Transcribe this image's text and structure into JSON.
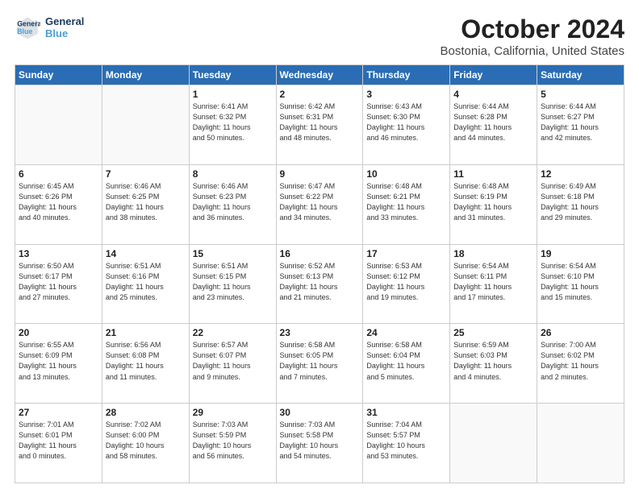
{
  "header": {
    "logo_line1": "General",
    "logo_line2": "Blue",
    "title": "October 2024",
    "subtitle": "Bostonia, California, United States"
  },
  "days_of_week": [
    "Sunday",
    "Monday",
    "Tuesday",
    "Wednesday",
    "Thursday",
    "Friday",
    "Saturday"
  ],
  "weeks": [
    [
      {
        "day": "",
        "detail": ""
      },
      {
        "day": "",
        "detail": ""
      },
      {
        "day": "1",
        "detail": "Sunrise: 6:41 AM\nSunset: 6:32 PM\nDaylight: 11 hours\nand 50 minutes."
      },
      {
        "day": "2",
        "detail": "Sunrise: 6:42 AM\nSunset: 6:31 PM\nDaylight: 11 hours\nand 48 minutes."
      },
      {
        "day": "3",
        "detail": "Sunrise: 6:43 AM\nSunset: 6:30 PM\nDaylight: 11 hours\nand 46 minutes."
      },
      {
        "day": "4",
        "detail": "Sunrise: 6:44 AM\nSunset: 6:28 PM\nDaylight: 11 hours\nand 44 minutes."
      },
      {
        "day": "5",
        "detail": "Sunrise: 6:44 AM\nSunset: 6:27 PM\nDaylight: 11 hours\nand 42 minutes."
      }
    ],
    [
      {
        "day": "6",
        "detail": "Sunrise: 6:45 AM\nSunset: 6:26 PM\nDaylight: 11 hours\nand 40 minutes."
      },
      {
        "day": "7",
        "detail": "Sunrise: 6:46 AM\nSunset: 6:25 PM\nDaylight: 11 hours\nand 38 minutes."
      },
      {
        "day": "8",
        "detail": "Sunrise: 6:46 AM\nSunset: 6:23 PM\nDaylight: 11 hours\nand 36 minutes."
      },
      {
        "day": "9",
        "detail": "Sunrise: 6:47 AM\nSunset: 6:22 PM\nDaylight: 11 hours\nand 34 minutes."
      },
      {
        "day": "10",
        "detail": "Sunrise: 6:48 AM\nSunset: 6:21 PM\nDaylight: 11 hours\nand 33 minutes."
      },
      {
        "day": "11",
        "detail": "Sunrise: 6:48 AM\nSunset: 6:19 PM\nDaylight: 11 hours\nand 31 minutes."
      },
      {
        "day": "12",
        "detail": "Sunrise: 6:49 AM\nSunset: 6:18 PM\nDaylight: 11 hours\nand 29 minutes."
      }
    ],
    [
      {
        "day": "13",
        "detail": "Sunrise: 6:50 AM\nSunset: 6:17 PM\nDaylight: 11 hours\nand 27 minutes."
      },
      {
        "day": "14",
        "detail": "Sunrise: 6:51 AM\nSunset: 6:16 PM\nDaylight: 11 hours\nand 25 minutes."
      },
      {
        "day": "15",
        "detail": "Sunrise: 6:51 AM\nSunset: 6:15 PM\nDaylight: 11 hours\nand 23 minutes."
      },
      {
        "day": "16",
        "detail": "Sunrise: 6:52 AM\nSunset: 6:13 PM\nDaylight: 11 hours\nand 21 minutes."
      },
      {
        "day": "17",
        "detail": "Sunrise: 6:53 AM\nSunset: 6:12 PM\nDaylight: 11 hours\nand 19 minutes."
      },
      {
        "day": "18",
        "detail": "Sunrise: 6:54 AM\nSunset: 6:11 PM\nDaylight: 11 hours\nand 17 minutes."
      },
      {
        "day": "19",
        "detail": "Sunrise: 6:54 AM\nSunset: 6:10 PM\nDaylight: 11 hours\nand 15 minutes."
      }
    ],
    [
      {
        "day": "20",
        "detail": "Sunrise: 6:55 AM\nSunset: 6:09 PM\nDaylight: 11 hours\nand 13 minutes."
      },
      {
        "day": "21",
        "detail": "Sunrise: 6:56 AM\nSunset: 6:08 PM\nDaylight: 11 hours\nand 11 minutes."
      },
      {
        "day": "22",
        "detail": "Sunrise: 6:57 AM\nSunset: 6:07 PM\nDaylight: 11 hours\nand 9 minutes."
      },
      {
        "day": "23",
        "detail": "Sunrise: 6:58 AM\nSunset: 6:05 PM\nDaylight: 11 hours\nand 7 minutes."
      },
      {
        "day": "24",
        "detail": "Sunrise: 6:58 AM\nSunset: 6:04 PM\nDaylight: 11 hours\nand 5 minutes."
      },
      {
        "day": "25",
        "detail": "Sunrise: 6:59 AM\nSunset: 6:03 PM\nDaylight: 11 hours\nand 4 minutes."
      },
      {
        "day": "26",
        "detail": "Sunrise: 7:00 AM\nSunset: 6:02 PM\nDaylight: 11 hours\nand 2 minutes."
      }
    ],
    [
      {
        "day": "27",
        "detail": "Sunrise: 7:01 AM\nSunset: 6:01 PM\nDaylight: 11 hours\nand 0 minutes."
      },
      {
        "day": "28",
        "detail": "Sunrise: 7:02 AM\nSunset: 6:00 PM\nDaylight: 10 hours\nand 58 minutes."
      },
      {
        "day": "29",
        "detail": "Sunrise: 7:03 AM\nSunset: 5:59 PM\nDaylight: 10 hours\nand 56 minutes."
      },
      {
        "day": "30",
        "detail": "Sunrise: 7:03 AM\nSunset: 5:58 PM\nDaylight: 10 hours\nand 54 minutes."
      },
      {
        "day": "31",
        "detail": "Sunrise: 7:04 AM\nSunset: 5:57 PM\nDaylight: 10 hours\nand 53 minutes."
      },
      {
        "day": "",
        "detail": ""
      },
      {
        "day": "",
        "detail": ""
      }
    ]
  ]
}
